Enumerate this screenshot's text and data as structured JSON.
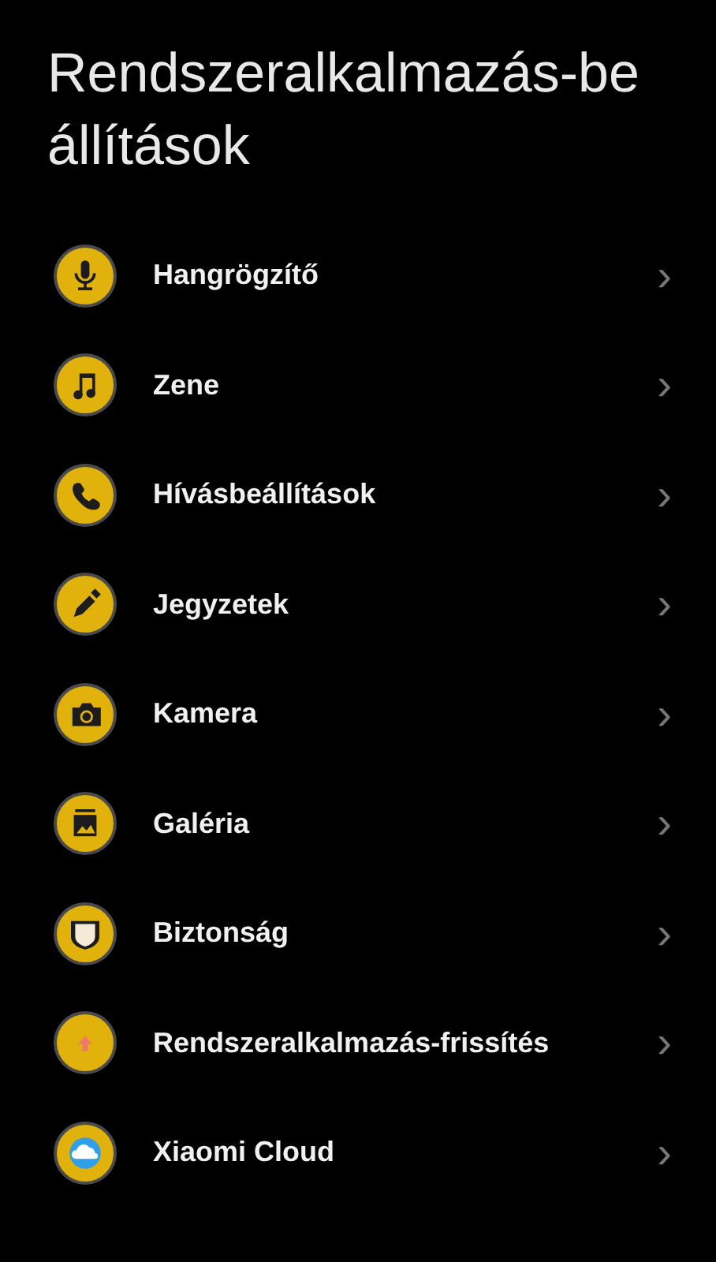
{
  "title": "Rendszeralkalmazás-beállítások",
  "items": [
    {
      "label": "Hangrögzítő",
      "kind": "mic",
      "chevron": "›"
    },
    {
      "label": "Zene",
      "kind": "music",
      "chevron": "›"
    },
    {
      "label": "Hívásbeállítások",
      "kind": "phone",
      "chevron": "›"
    },
    {
      "label": "Jegyzetek",
      "kind": "pen",
      "chevron": "›"
    },
    {
      "label": "Kamera",
      "kind": "camera",
      "chevron": "›"
    },
    {
      "label": "Galéria",
      "kind": "gallery",
      "chevron": "›"
    },
    {
      "label": "Biztonság",
      "kind": "shield",
      "chevron": "›"
    },
    {
      "label": "Rendszeralkalmazás-frissítés",
      "kind": "update",
      "chevron": "›"
    },
    {
      "label": "Xiaomi Cloud",
      "kind": "cloud",
      "chevron": "›"
    }
  ]
}
